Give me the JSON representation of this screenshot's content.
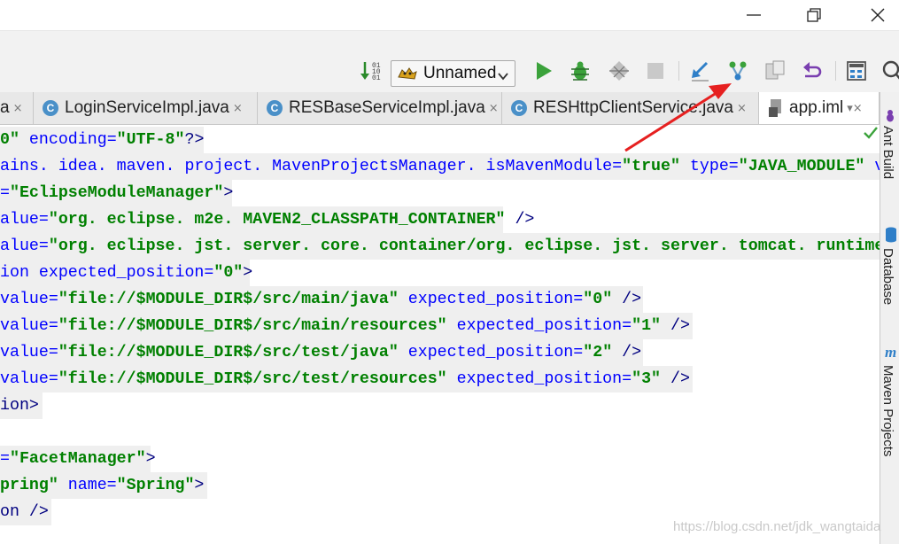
{
  "window": {
    "controls": {
      "minimize": "minimize-icon",
      "maximize": "maximize-icon",
      "close": "close-icon"
    }
  },
  "toolbar": {
    "run_config": "Unnamed",
    "icons": [
      "sort-icon",
      "run-config-icon",
      "run-icon",
      "debug-icon",
      "coverage-icon",
      "stop-icon",
      "vcs-update-icon",
      "vcs-branch-icon",
      "vcs-compare-icon",
      "revert-icon",
      "structure-icon",
      "search-icon"
    ]
  },
  "tabs": [
    {
      "label": "a",
      "icon": "C",
      "close": "×"
    },
    {
      "label": "LoginServiceImpl.java",
      "icon": "C",
      "close": "×"
    },
    {
      "label": "RESBaseServiceImpl.java",
      "icon": "C",
      "close": "×"
    },
    {
      "label": "RESHttpClientService.java",
      "icon": "C",
      "close": "×"
    },
    {
      "label": "app.iml",
      "icon": "file-icon",
      "close": "▾×"
    }
  ],
  "editor": {
    "lines": [
      [
        "0\"",
        " encoding=",
        "\"UTF-8\"",
        "?>"
      ],
      [
        "ains. idea. maven. project. MavenProjectsManager. isMavenModule=",
        "",
        "\"true\"",
        " type=",
        "\"JAVA_MODULE\"",
        " versio"
      ],
      [
        "=",
        "\"EclipseModuleManager\"",
        ">"
      ],
      [
        "alue=",
        "\"org. eclipse. m2e. MAVEN2_CLASSPATH_CONTAINER\"",
        " />"
      ],
      [
        "alue=",
        "\"org. eclipse. jst. server. core. container/org. eclipse. jst. server. tomcat. runtimeTarget/Apa"
      ],
      [
        "ion expected_position=",
        "\"0\"",
        ">"
      ],
      [
        "value=",
        "\"file://$MODULE_DIR$/src/main/java\"",
        " expected_position=",
        "\"0\"",
        " />"
      ],
      [
        "value=",
        "\"file://$MODULE_DIR$/src/main/resources\"",
        " expected_position=",
        "\"1\"",
        " />"
      ],
      [
        "value=",
        "\"file://$MODULE_DIR$/src/test/java\"",
        " expected_position=",
        "\"2\"",
        " />"
      ],
      [
        "value=",
        "\"file://$MODULE_DIR$/src/test/resources\"",
        " expected_position=",
        "\"3\"",
        " />"
      ],
      [
        "ion>"
      ],
      [
        ""
      ],
      [
        "=",
        "\"FacetManager\"",
        ">"
      ],
      [
        "pring\"",
        " name=",
        "\"Spring\"",
        ">"
      ],
      [
        "on />"
      ]
    ]
  },
  "side_panel": [
    "Ant Build",
    "Database",
    "Maven Projects"
  ],
  "watermark": "https://blog.csdn.net/jdk_wangtaida"
}
